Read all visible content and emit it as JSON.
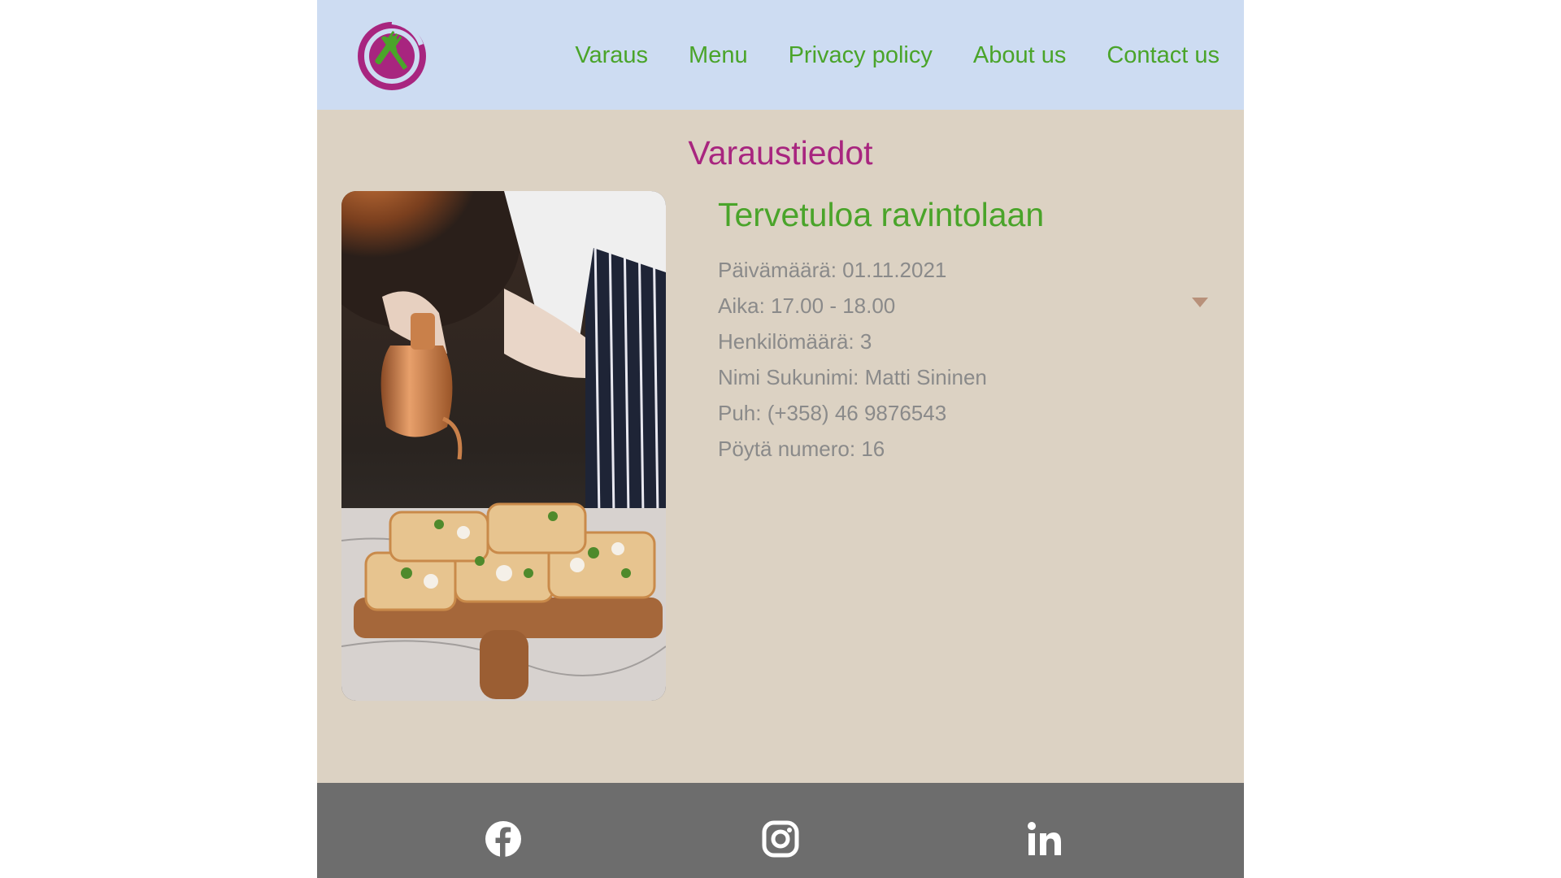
{
  "header": {
    "logo_name": "restaurant-logo",
    "nav": [
      {
        "label": "Varaus"
      },
      {
        "label": "Menu"
      },
      {
        "label": "Privacy policy"
      },
      {
        "label": "About us"
      },
      {
        "label": "Contact us"
      }
    ]
  },
  "main": {
    "title": "Varaustiedot",
    "welcome": "Tervetuloa ravintolaan",
    "details": [
      "Päivämäärä: 01.11.2021",
      "Aika: 17.00 - 18.00",
      "Henkilömäärä: 3",
      "Nimi Sukunimi: Matti Sininen",
      "Puh: (+358) 46 9876543",
      "Pöytä numero: 16"
    ],
    "photo_alt_icon": "chef-pouring-oil-on-pizza-photo"
  },
  "footer": {
    "social": [
      "facebook-icon",
      "instagram-icon",
      "linkedin-icon"
    ]
  },
  "colors": {
    "header_bg": "#cddcf2",
    "page_bg": "#dcd2c3",
    "footer_bg": "#6d6d6d",
    "nav_green": "#4aa42a",
    "title_magenta": "#a8257f",
    "text_gray": "#8a8a8a"
  }
}
